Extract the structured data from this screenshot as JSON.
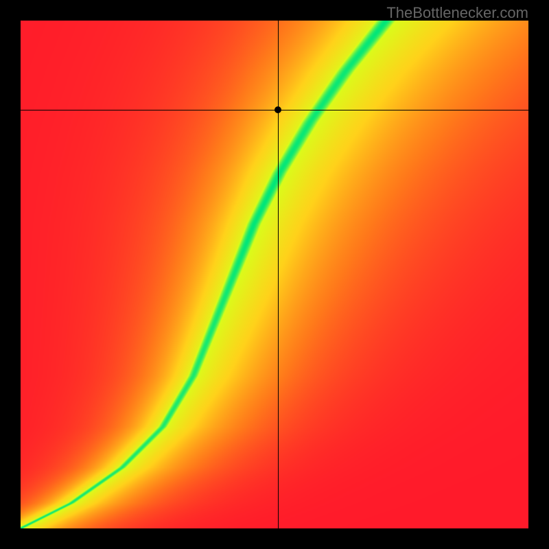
{
  "watermark": "TheBottlenecker.com",
  "chart_data": {
    "type": "heatmap",
    "title": "",
    "xlabel": "",
    "ylabel": "",
    "xlim": [
      0,
      1
    ],
    "ylim": [
      0,
      1
    ],
    "marker": {
      "x": 0.507,
      "y": 0.825
    },
    "crosshair": {
      "x": 0.507,
      "y": 0.825
    },
    "green_ridge": {
      "description": "Optimal balance curve (monotone S-shape from bottom-left to upper area)",
      "points": [
        {
          "x": 0.0,
          "y": 0.0
        },
        {
          "x": 0.1,
          "y": 0.05
        },
        {
          "x": 0.2,
          "y": 0.12
        },
        {
          "x": 0.28,
          "y": 0.2
        },
        {
          "x": 0.34,
          "y": 0.3
        },
        {
          "x": 0.38,
          "y": 0.4
        },
        {
          "x": 0.42,
          "y": 0.5
        },
        {
          "x": 0.46,
          "y": 0.6
        },
        {
          "x": 0.51,
          "y": 0.7
        },
        {
          "x": 0.57,
          "y": 0.8
        },
        {
          "x": 0.64,
          "y": 0.9
        },
        {
          "x": 0.72,
          "y": 1.0
        }
      ]
    },
    "color_scale": {
      "0.0": "#ff1a2a",
      "0.25": "#ff7a1a",
      "0.5": "#ffd21a",
      "0.75": "#d8ff1a",
      "1.0": "#00e67a"
    },
    "grid": false,
    "resolution": 120
  }
}
